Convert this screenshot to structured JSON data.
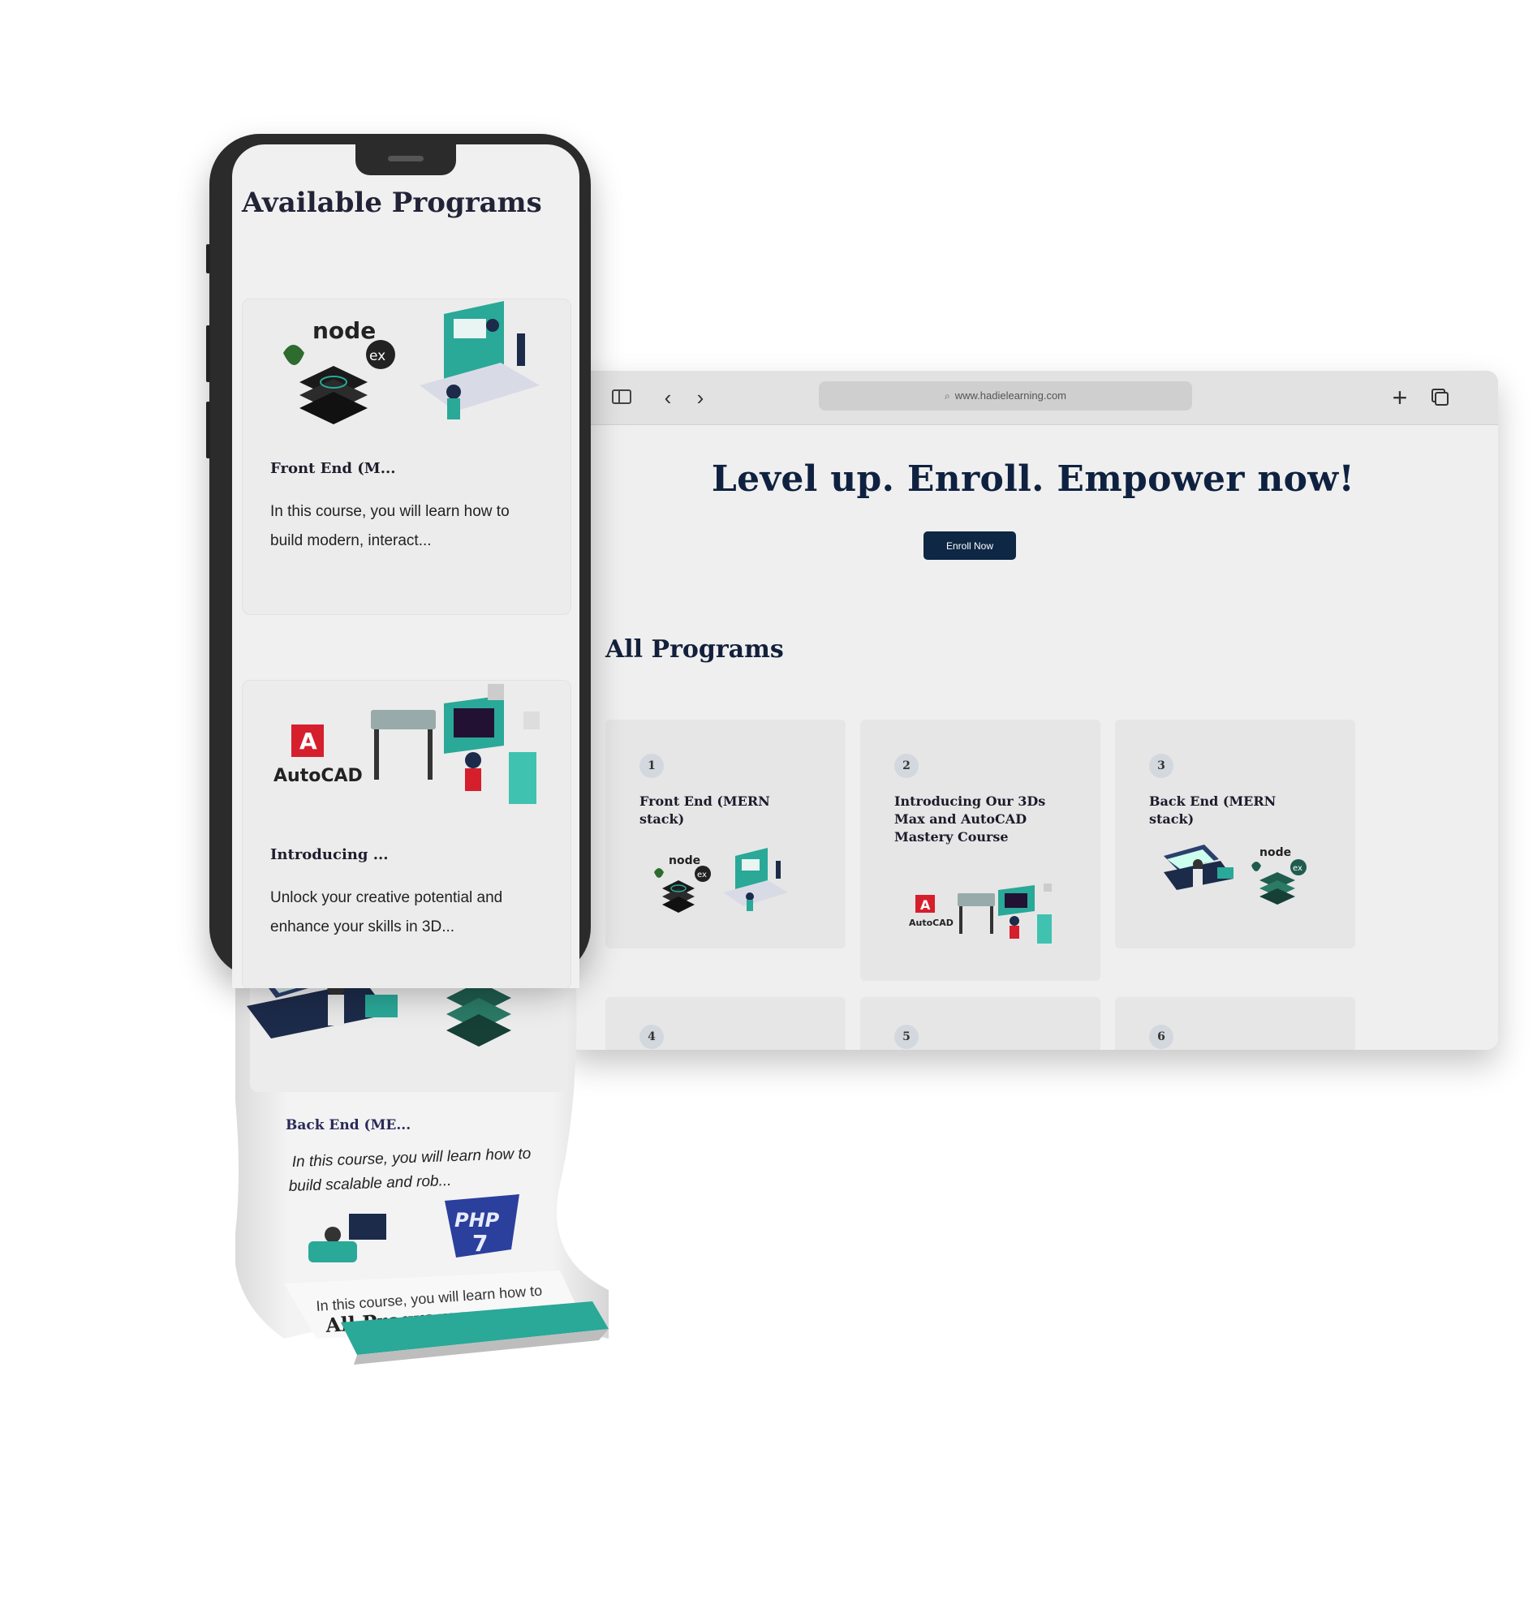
{
  "browser": {
    "url": "www.hadielearning.com",
    "hero_title": "Level up. Enroll. Empower now!",
    "enroll_label": "Enroll Now",
    "section_title": "All Programs",
    "cards": [
      {
        "number": "1",
        "title": "Front End (MERN stack)"
      },
      {
        "number": "2",
        "title": "Introducing Our 3Ds Max and AutoCAD Mastery Course"
      },
      {
        "number": "3",
        "title": "Back End (MERN stack)"
      },
      {
        "number": "4"
      },
      {
        "number": "5"
      },
      {
        "number": "6"
      }
    ]
  },
  "phone": {
    "title": "Available Programs",
    "cards": [
      {
        "title": "Front End (M...",
        "description": "In this course, you will learn how to build modern, interact..."
      },
      {
        "title": "Introducing ...",
        "description": "Unlock your creative potential and enhance your skills in 3D..."
      }
    ],
    "strip": {
      "card_title": "Back End (ME...",
      "card_desc_line1": "In this course, you will learn how to",
      "card_desc_line2": "build scalable and rob...",
      "next_desc": "In this course, you will learn how to",
      "next_title": "All Programs"
    }
  },
  "logos": {
    "node": "node",
    "express": "ex",
    "autocad": "AutoCAD",
    "autocad_mark": "A",
    "php": "PHP",
    "php_version": "7"
  },
  "colors": {
    "navy": "#0d2744",
    "teal": "#2aa898",
    "autocad_red": "#d61f2c",
    "php_blue": "#2b3f9c"
  }
}
